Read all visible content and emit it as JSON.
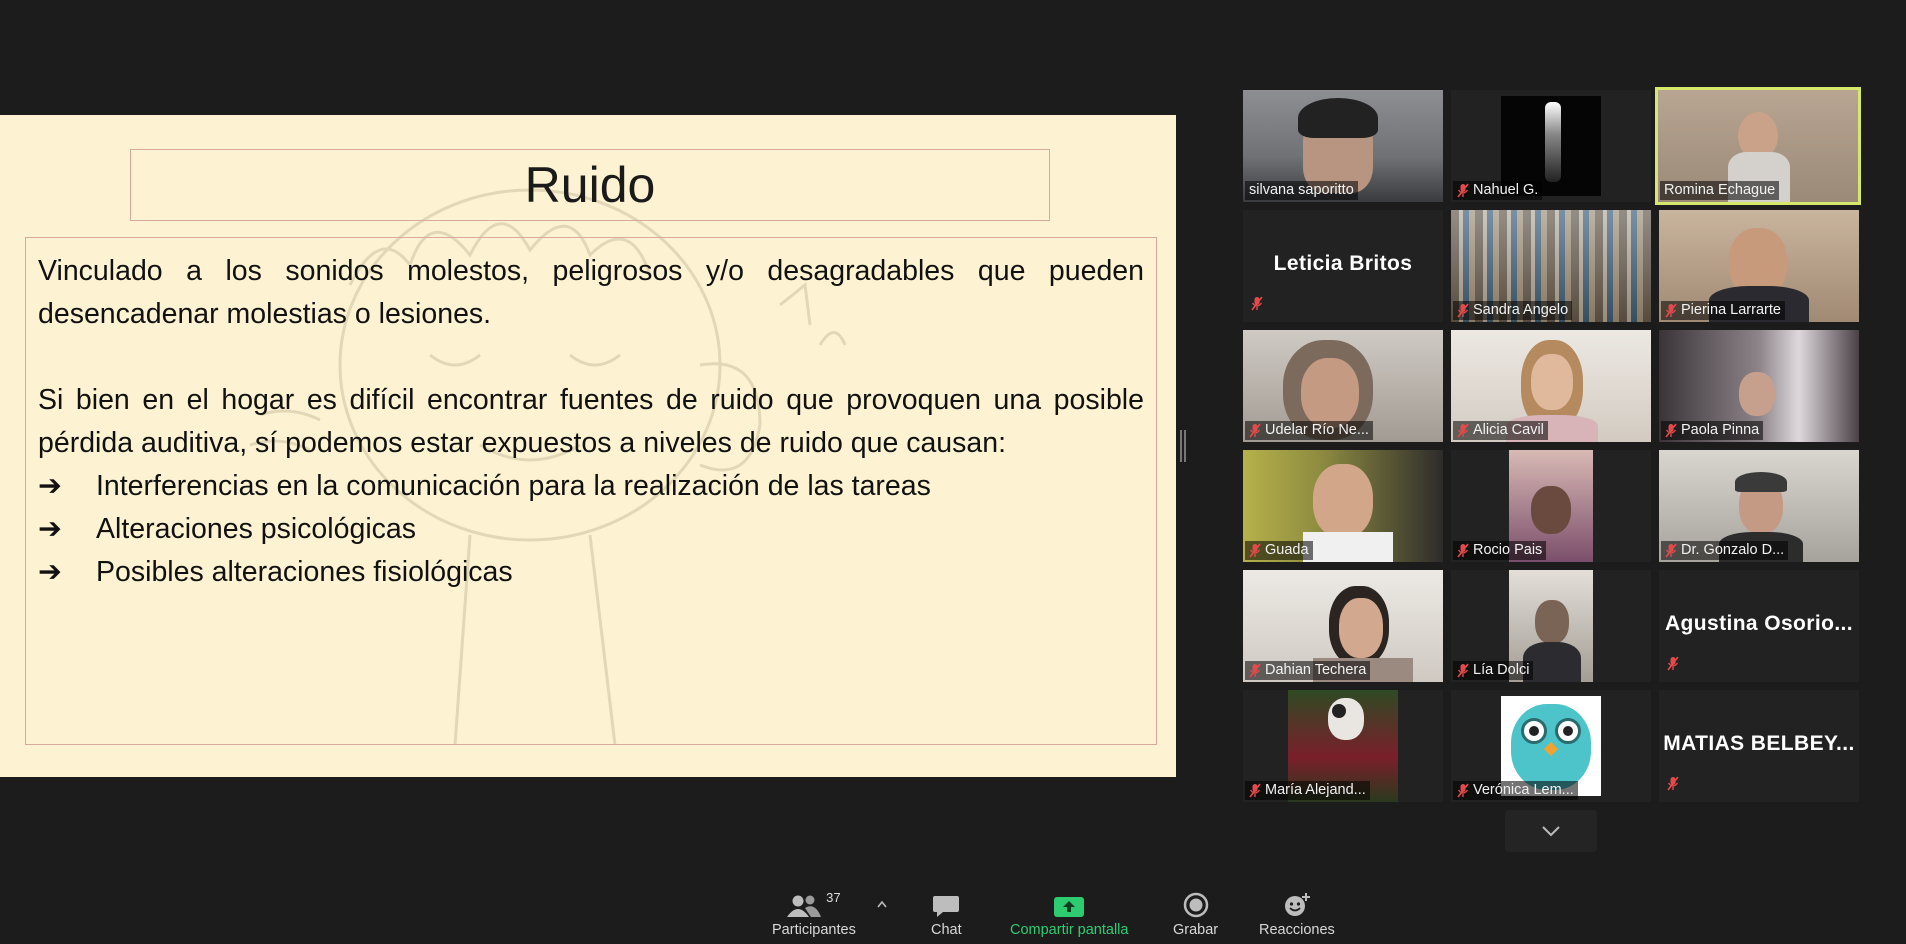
{
  "slide": {
    "title": "Ruido",
    "paragraph1": "Vinculado a los sonidos molestos, peligrosos y/o desagradables que pueden desencadenar molestias o lesiones.",
    "paragraph2": "Si bien en el hogar es difícil encontrar fuentes de ruido que provoquen una posible pérdida auditiva, sí podemos estar expuestos a niveles de ruido que causan:",
    "bullet_glyph": "➔",
    "bullets": [
      "Interferencias en la comunicación para la realización de las tareas",
      "Alteraciones psicológicas",
      "Posibles alteraciones fisiológicas"
    ]
  },
  "gallery": {
    "tiles": [
      {
        "name": "silvana saporitto",
        "muted": false,
        "active": false
      },
      {
        "name": "Nahuel G.",
        "muted": true,
        "active": false
      },
      {
        "name": "Romina Echague",
        "muted": false,
        "active": true
      },
      {
        "name": "Leticia Britos",
        "muted": true,
        "video": false
      },
      {
        "name": "Sandra Angelo",
        "muted": true
      },
      {
        "name": "Pierina Larrarte",
        "muted": true
      },
      {
        "name": "Udelar Río Ne...",
        "muted": true
      },
      {
        "name": "Alicia Cavil",
        "muted": true
      },
      {
        "name": "Paola Pinna",
        "muted": true
      },
      {
        "name": "Guada",
        "muted": true
      },
      {
        "name": "Rocio Pais",
        "muted": true
      },
      {
        "name": "Dr. Gonzalo D...",
        "muted": true
      },
      {
        "name": "Dahian Techera",
        "muted": true
      },
      {
        "name": "Lía Dolci",
        "muted": true
      },
      {
        "name": "Agustina  Osorio...",
        "muted": true,
        "video": false
      },
      {
        "name": "María Alejand...",
        "muted": true
      },
      {
        "name": "Verónica Lem...",
        "muted": true
      },
      {
        "name": "MATIAS  BELBEY...",
        "muted": true,
        "video": false
      }
    ]
  },
  "toolbar": {
    "participants_label": "Participantes",
    "participants_count": "37",
    "chat_label": "Chat",
    "share_label": "Compartir pantalla",
    "record_label": "Grabar",
    "reactions_label": "Reacciones"
  },
  "colors": {
    "background": "#1c1c1c",
    "slide_bg": "#fdf3d2",
    "slide_border": "#d9a9a0",
    "active_speaker": "#d6e86b",
    "share_green": "#2ecc71",
    "mute_red": "#e24b4b"
  },
  "icons": [
    "participants-icon",
    "caret-up-icon",
    "chat-icon",
    "share-screen-icon",
    "record-icon",
    "reactions-icon",
    "mic-off-icon",
    "chevron-down-icon"
  ]
}
